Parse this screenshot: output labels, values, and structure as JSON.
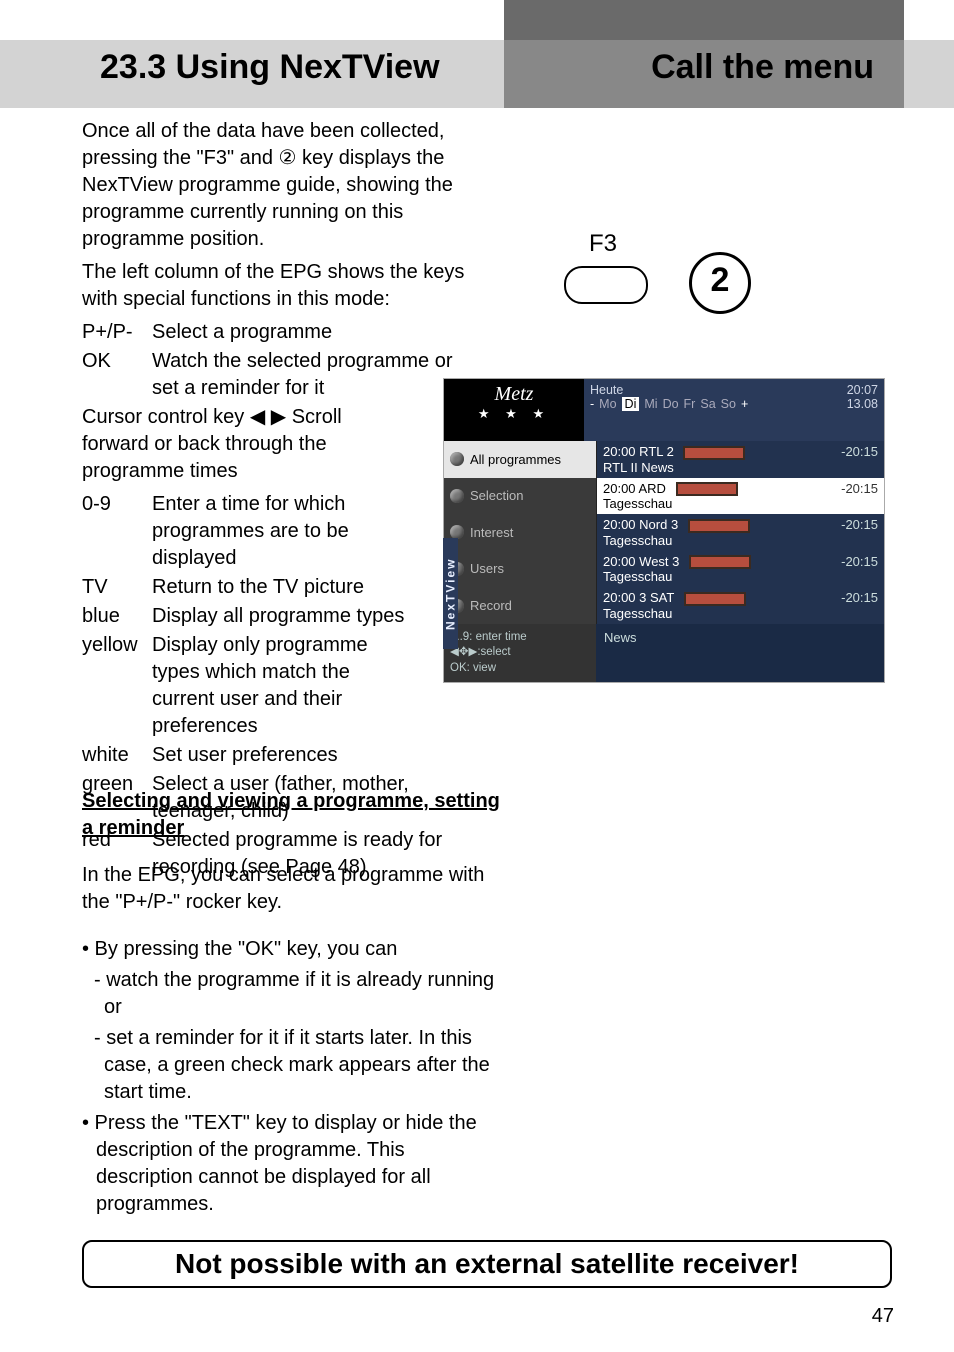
{
  "header": {
    "title_left": "23.3 Using NexTView",
    "title_right": "Call the menu"
  },
  "intro": {
    "p1": "Once all of the data have been collected, pressing the \"F3\" and ② key displays the NexTView programme guide, showing the programme currently running on this programme position.",
    "p2": "The left column of the EPG shows the keys with special functions in this mode:"
  },
  "keys": [
    {
      "k": "P+/P-",
      "v": "Select a programme"
    },
    {
      "k": "OK",
      "v": "Watch the selected programme or set a reminder for it"
    }
  ],
  "cursor_line": "Cursor control key ◀ ▶ Scroll forward or back through the programme times",
  "keys2": [
    {
      "k": "0-9",
      "v": "Enter a time for which programmes are to be displayed"
    },
    {
      "k": "TV",
      "v": "Return to the TV picture"
    },
    {
      "k": "blue",
      "v": "Display all programme types"
    },
    {
      "k": "yellow",
      "v": "Display only programme types which match the current user and their preferences"
    },
    {
      "k": "white",
      "v": "Set user preferences"
    },
    {
      "k": "green",
      "v": "Select a user (father, mother, teenager, child)"
    },
    {
      "k": "red",
      "v": "Selected programme is ready for recording (see Page 48)"
    }
  ],
  "section2": {
    "heading": "Selecting and viewing a programme, setting a reminder",
    "p1": "In the EPG, you can select a programme with the \"P+/P-\" rocker key.",
    "b1": "• By pressing the \"OK\" key, you can",
    "d1": "- watch the programme if it is already running or",
    "d2": "- set a reminder for it if it starts later. In this case, a green check mark appears after the start time.",
    "b2": "• Press the \"TEXT\" key to display or hide the description of the programme. This description cannot be displayed for all programmes."
  },
  "footnote": "Not possible with an external satellite receiver!",
  "page_number": "47",
  "remote": {
    "f3": "F3",
    "num": "2"
  },
  "osd": {
    "logo": "Metz",
    "stars": "★  ★  ★",
    "heute": "Heute",
    "clock": "20:07",
    "date": "13.08",
    "days": {
      "minus": "-",
      "mo": "Mo",
      "di": "Di",
      "mi": "Mi",
      "do": "Do",
      "fr": "Fr",
      "sa": "Sa",
      "so": "So",
      "plus": "+"
    },
    "sidebar": [
      "All programmes",
      "Selection",
      "Interest",
      "Users",
      "Record"
    ],
    "rows": [
      {
        "time": "20:00",
        "ch": "RTL 2",
        "title": "RTL II News",
        "end": "-20:15"
      },
      {
        "time": "20:00",
        "ch": "ARD",
        "title": "Tagesschau",
        "end": "-20:15"
      },
      {
        "time": "20:00",
        "ch": "Nord 3",
        "title": "Tagesschau",
        "end": "-20:15"
      },
      {
        "time": "20:00",
        "ch": "West 3",
        "title": "Tagesschau",
        "end": "-20:15"
      },
      {
        "time": "20:00",
        "ch": "3 SAT",
        "title": "Tagesschau",
        "end": "-20:15"
      }
    ],
    "help": {
      "l1": "0..9: enter time",
      "l2": "◀✥▶:select",
      "l3": "OK: view"
    },
    "news": "News",
    "vlabel": "NexTView"
  }
}
